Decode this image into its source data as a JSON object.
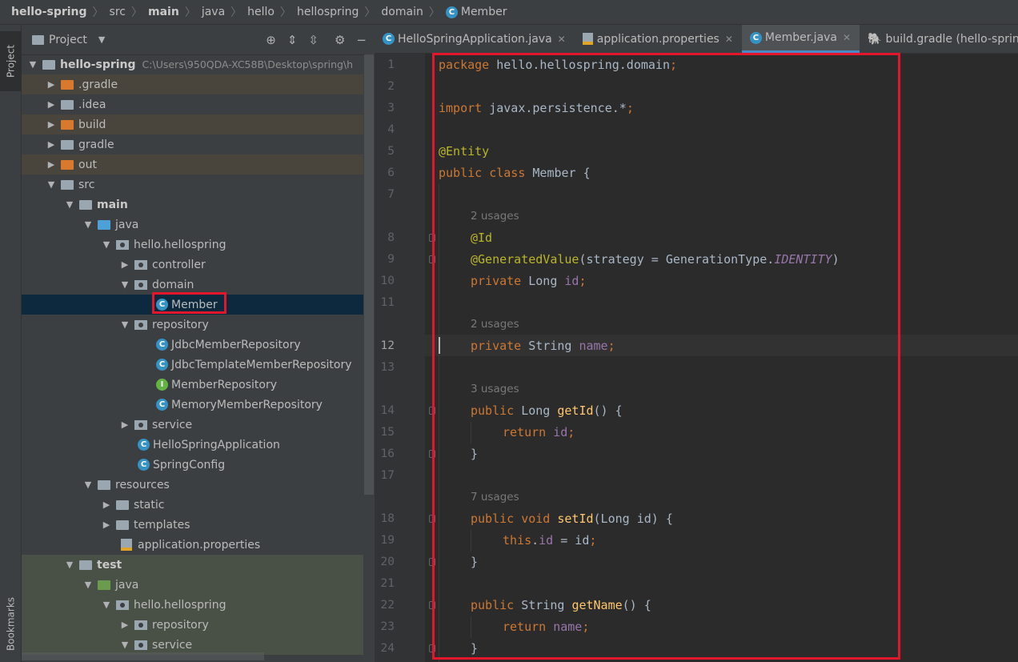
{
  "breadcrumb": {
    "items": [
      "hello-spring",
      "src",
      "main",
      "java",
      "hello",
      "hellospring",
      "domain",
      "Member"
    ]
  },
  "side_tabs": {
    "project": "Project",
    "bookmarks": "Bookmarks"
  },
  "project_panel": {
    "title": "Project",
    "root_name": "hello-spring",
    "root_path": "C:\\Users\\950QDA-XC58B\\Desktop\\spring\\h",
    "tree": [
      {
        "label": ".gradle"
      },
      {
        "label": ".idea"
      },
      {
        "label": "build"
      },
      {
        "label": "gradle"
      },
      {
        "label": "out"
      },
      {
        "label": "src"
      },
      {
        "label": "main"
      },
      {
        "label": "java"
      },
      {
        "label": "hello.hellospring"
      },
      {
        "label": "controller"
      },
      {
        "label": "domain"
      },
      {
        "label": "Member"
      },
      {
        "label": "repository"
      },
      {
        "label": "JdbcMemberRepository"
      },
      {
        "label": "JdbcTemplateMemberRepository"
      },
      {
        "label": "MemberRepository"
      },
      {
        "label": "MemoryMemberRepository"
      },
      {
        "label": "service"
      },
      {
        "label": "HelloSpringApplication"
      },
      {
        "label": "SpringConfig"
      },
      {
        "label": "resources"
      },
      {
        "label": "static"
      },
      {
        "label": "templates"
      },
      {
        "label": "application.properties"
      },
      {
        "label": "test"
      },
      {
        "label": "java"
      },
      {
        "label": "hello.hellospring"
      },
      {
        "label": "repository"
      },
      {
        "label": "service"
      }
    ]
  },
  "tabs": [
    {
      "label": "HelloSpringApplication.java"
    },
    {
      "label": "application.properties"
    },
    {
      "label": "Member.java"
    },
    {
      "label": "build.gradle (hello-spring)"
    }
  ],
  "editor": {
    "line_numbers": [
      "1",
      "2",
      "3",
      "4",
      "5",
      "6",
      "7",
      "8",
      "9",
      "10",
      "11",
      "12",
      "13",
      "14",
      "15",
      "16",
      "17",
      "18",
      "19",
      "20",
      "21",
      "22",
      "23",
      "24"
    ],
    "usages": [
      "2 usages",
      "2 usages",
      "3 usages",
      "7 usages"
    ],
    "code": {
      "l1_kw": "package",
      "l1_rest": " hello.hellospring.domain",
      "l1_semi": ";",
      "l3_kw": "import",
      "l3_rest": " javax.persistence.*",
      "l3_semi": ";",
      "l5_ann": "@Entity",
      "l6_kw": "public class",
      "l6_rest": " Member {",
      "l8_ann": "@Id",
      "l9_ann": "@GeneratedValue",
      "l9_rest": "(strategy = GenerationType.",
      "l9_const": "IDENTITY",
      "l9_end": ")",
      "l10_kw": "private",
      "l10_type": " Long ",
      "l10_fld": "id",
      "l10_semi": ";",
      "l12_kw": "private",
      "l12_type": " String ",
      "l12_fld": "name",
      "l12_semi": ";",
      "l14_kw": "public",
      "l14_type": " Long ",
      "l14_mth": "getId",
      "l14_rest": "() {",
      "l15_kw": "return",
      "l15_fld": " id",
      "l15_semi": ";",
      "l16": "}",
      "l18_kw": "public void",
      "l18_mth": " setId",
      "l18_rest": "(Long id) {",
      "l19_kw": "this",
      "l19_dot": ".",
      "l19_fld": "id",
      "l19_rest": " = id",
      "l19_semi": ";",
      "l20": "}",
      "l22_kw": "public",
      "l22_type": " String ",
      "l22_mth": "getName",
      "l22_rest": "() {",
      "l23_kw": "return",
      "l23_fld": " name",
      "l23_semi": ";",
      "l24": "}"
    }
  },
  "colors": {
    "highlight_box": "#e3162b",
    "selection": "#0d293e",
    "keyword": "#cc7832",
    "annotation": "#bbb529",
    "field": "#9876aa",
    "method": "#ffc66d"
  }
}
